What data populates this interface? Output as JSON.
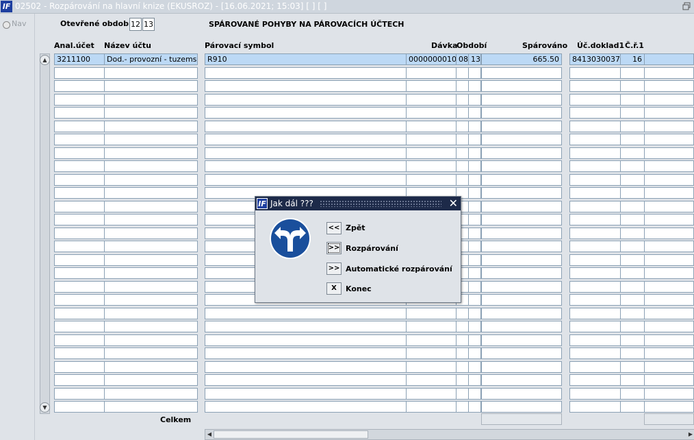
{
  "window": {
    "title": "02502 - Rozpárování na hlavní knize (EKUSROZ) - [16.06.2021; 15:03]  [ ]  [ ]",
    "app_icon": "IF"
  },
  "nav": {
    "label": "Nav"
  },
  "header": {
    "open_period_label": "Otevřené období",
    "open_period_values": [
      "12",
      "13"
    ],
    "section_title": "SPÁROVANÉ POHYBY NA PÁROVACÍCH ÚČTECH"
  },
  "columns": {
    "anal_ucet": "Anal.účet",
    "nazev_uctu": "Název účtu",
    "parovaci_symbol": "Párovací symbol",
    "davka": "Dávka",
    "obdobi": "Období",
    "sparovano": "Spárováno",
    "uc_doklad1": "Úč.doklad1",
    "cr1": "Č.ř.1"
  },
  "rows": [
    {
      "anal_ucet": "3211100",
      "nazev_uctu": "Dod.- provozní - tuzemsko,",
      "parovaci_symbol": "R910",
      "davka": "0000000010",
      "obdobi_a": "08",
      "obdobi_b": "13",
      "sparovano": "665.50",
      "uc_doklad1": "8413030037",
      "cr1": "16"
    }
  ],
  "footer": {
    "total_label": "Celkem"
  },
  "dialog": {
    "title": "Jak dál ???",
    "close_icon": "close-icon",
    "sign_icon": "turn-left-or-right-sign-icon",
    "options": [
      {
        "button": "<<",
        "label": "Zpět"
      },
      {
        "button": ">>",
        "label": "Rozpárování"
      },
      {
        "button": ">>",
        "label": "Automatické rozpárování"
      },
      {
        "button": "X",
        "label": "Konec"
      }
    ]
  },
  "colors": {
    "selected_row": "#bcd9f5",
    "title_bar": "#cfd6de",
    "dialog_title": "#1d2a49",
    "sign_blue": "#1a4f9c"
  }
}
